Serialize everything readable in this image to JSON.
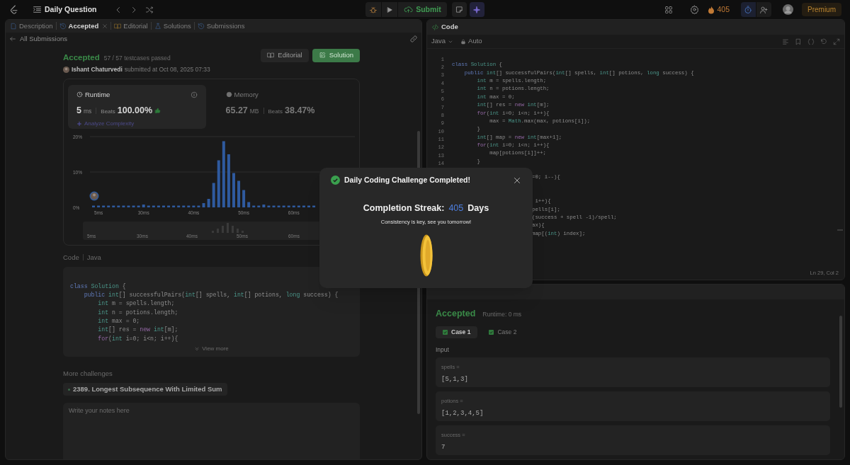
{
  "topbar": {
    "title": "Daily Question",
    "submit": "Submit",
    "streak": "405",
    "premium": "Premium"
  },
  "left_tabs": [
    {
      "label": "Description",
      "selected": false,
      "closable": false
    },
    {
      "label": "Accepted",
      "selected": true,
      "closable": true
    },
    {
      "label": "Editorial",
      "selected": false,
      "closable": false
    },
    {
      "label": "Solutions",
      "selected": false,
      "closable": false
    },
    {
      "label": "Submissions",
      "selected": false,
      "closable": false
    }
  ],
  "back_link": "All Submissions",
  "submission": {
    "status": "Accepted",
    "testcases": "57 / 57 testcases passed",
    "user": "Ishant Chaturvedi",
    "submitted": "submitted at Oct 08, 2025 07:33"
  },
  "actions": [
    {
      "kind": "editorial",
      "label": "Editorial"
    },
    {
      "kind": "solution",
      "label": "Solution"
    }
  ],
  "stats": [
    {
      "kind": "runtime",
      "label": "Runtime",
      "value": "5",
      "unit": "ms",
      "beats_label": "Beats",
      "beats": "100.00%",
      "selected": true,
      "link": "Analyze Complexity"
    },
    {
      "kind": "memory",
      "label": "Memory",
      "value": "65.27",
      "unit": "MB",
      "beats_label": "Beats",
      "beats": "38.47%",
      "selected": false
    }
  ],
  "chart_data": {
    "type": "bar",
    "yticks": [
      {
        "value": 0,
        "label": "0%"
      },
      {
        "value": 10,
        "label": "10%"
      },
      {
        "value": 20,
        "label": "20%"
      }
    ],
    "ylim": [
      0,
      20
    ],
    "categories": [
      null,
      "5ms",
      null,
      null,
      null,
      null,
      null,
      null,
      null,
      null,
      "30ms",
      null,
      null,
      null,
      null,
      null,
      null,
      null,
      null,
      null,
      "40ms",
      null,
      null,
      null,
      null,
      null,
      null,
      null,
      null,
      null,
      "50ms",
      null,
      null,
      null,
      null,
      null,
      null,
      null,
      null,
      null,
      "60ms",
      null,
      null,
      null,
      null
    ],
    "values": [
      0.5,
      0.5,
      0.5,
      0.5,
      0.5,
      0.5,
      0.5,
      0.5,
      0.5,
      0.5,
      0.8,
      0.5,
      0.5,
      0.5,
      0.5,
      0.5,
      0.5,
      0.5,
      0.5,
      0.5,
      0.5,
      0.5,
      1.2,
      2.4,
      6.9,
      13.3,
      18.7,
      15.0,
      9.7,
      7.5,
      4.9,
      1.5,
      0.5,
      0.5,
      0.8,
      0.5,
      0.5,
      0.5,
      0.5,
      0.5,
      0.5,
      0.5,
      0.5,
      0.5,
      0.5
    ]
  },
  "navigator_labels": [
    "5ms",
    "30ms",
    "40ms",
    "50ms",
    "60ms"
  ],
  "code_section": {
    "label": "Code",
    "language": "Java",
    "view_more": "View more",
    "lines": [
      "class Solution {",
      "    public int[] successfulPairs(int[] spells, int[] potions, long success) {",
      "        int m = spells.length;",
      "        int n = potions.length;",
      "        int max = 0;",
      "        int[] res = new int[m];",
      "        for(int i=0; i<n; i++){"
    ]
  },
  "more_challenges": {
    "label": "More challenges",
    "items": [
      "2389. Longest Subsequence With Limited Sum"
    ]
  },
  "notes": {
    "placeholder": "Write your notes here"
  },
  "editor": {
    "title": "Code",
    "language": "Java",
    "mode": "Auto",
    "cursor": "Ln 29, Col 2",
    "lines": [
      {
        "number": "1"
      },
      {
        "number": "2",
        "text": "class Solution {"
      },
      {
        "number": "3",
        "text": "    public int[] successfulPairs(int[] spells, int[] potions, long success) {"
      },
      {
        "number": "4",
        "text": "        int m = spells.length;"
      },
      {
        "number": "5",
        "text": "        int n = potions.length;"
      },
      {
        "number": "6",
        "text": "        int max = 0;"
      },
      {
        "number": "7",
        "text": "        int[] res = new int[m];"
      },
      {
        "number": "8",
        "text": "        for(int i=0; i<n; i++){"
      },
      {
        "number": "9",
        "text": "            max = Math.max(max, potions[i]);"
      },
      {
        "number": "10",
        "text": "        }"
      },
      {
        "number": "11",
        "text": "        int[] map = new int[max+1];"
      },
      {
        "number": "12",
        "text": "        for(int i=0; i<n; i++){"
      },
      {
        "number": "13",
        "text": "            map[potions[i]]++;"
      },
      {
        "number": "14",
        "text": "        }"
      }
    ],
    "covered_text": "=0; i--){\n\n\n i++){\npells[i];\n(success + spell -1)/spell;\nax){\nmap[(int) index];"
  },
  "result": {
    "status": "Accepted",
    "runtime": "Runtime: 0 ms",
    "input_label": "Input",
    "cases": [
      {
        "label": "Case 1",
        "selected": true,
        "passed": true
      },
      {
        "label": "Case 2",
        "selected": false,
        "passed": true
      }
    ],
    "inputs": [
      {
        "name": "spells =",
        "value": "[5,1,3]"
      },
      {
        "name": "potions =",
        "value": "[1,2,3,4,5]"
      },
      {
        "name": "success =",
        "value": "7"
      }
    ]
  },
  "modal": {
    "title": "Daily Coding Challenge Completed!",
    "streak_label": "Completion Streak:",
    "streak": "405",
    "streak_unit": "Days",
    "message": "Consistency is key, see you tomorrow!"
  }
}
